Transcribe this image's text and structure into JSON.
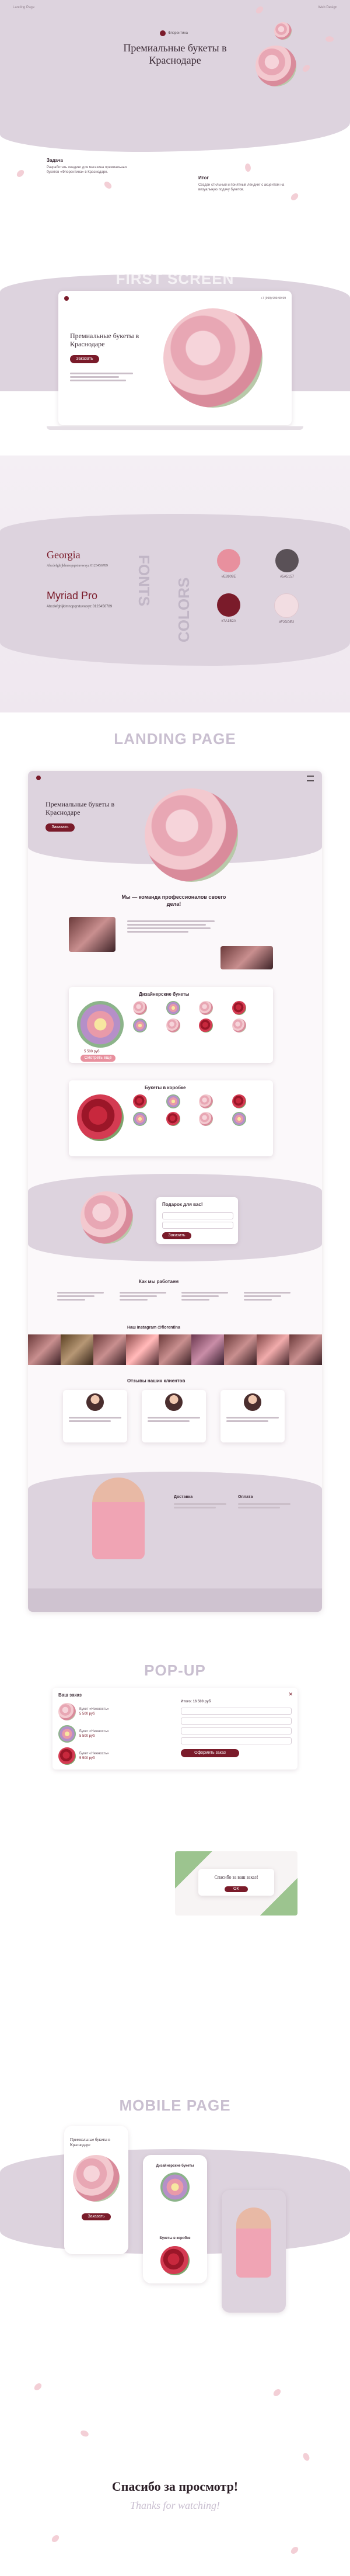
{
  "hero": {
    "top_left_text": "Landing Page",
    "top_right_text": "Web Design",
    "logo_text": "Флорентина",
    "title": "Премиальные букеты в Краснодаре",
    "task_title": "Задача",
    "task_text": "Разработать лендинг для магазина премиальных букетов «Флорентина» в Краснодаре.",
    "result_title": "Итог",
    "result_text": "Создан стильный и понятный лендинг с акцентом на визуальную подачу букетов."
  },
  "first_screen": {
    "section_title": "FIRST SCREEN",
    "mock_title": "Премиальные букеты в Краснодаре",
    "mock_button": "Заказать",
    "phone": "+7 (999) 999-99-99"
  },
  "style": {
    "font1_name": "Georgia",
    "font1_sample": "Abcdefghijklmnopqrstuvwxyz 0123456789",
    "font2_name": "Myriad Pro",
    "font2_sample": "Abcdefghijklmnopqrstuvwxyz 0123456789",
    "fonts_label": "FONTS",
    "colors_label": "COLORS",
    "colors": [
      {
        "hex": "#e8909e",
        "label": "#E8909E"
      },
      {
        "hex": "#5a5157",
        "label": "#5A5157"
      },
      {
        "hex": "#7a1b2a",
        "label": "#7A1B2A"
      },
      {
        "hex": "#f2dde2",
        "label": "#F2DDE2"
      }
    ]
  },
  "landing": {
    "section_title": "LANDING PAGE",
    "hero_title": "Премиальные букеты в Краснодаре",
    "hero_button": "Заказать",
    "about_title": "Мы — команда профессионалов своего дела!",
    "designer_title": "Дизайнерские букеты",
    "boxes_title": "Букеты в коробке",
    "gift_title": "Подарок для вас!",
    "how_title": "Как мы работаем",
    "insta_title": "Наш Instagram @florentina",
    "reviews_title": "Отзывы наших клиентов",
    "delivery_title": "Доставка",
    "payment_title": "Оплата",
    "price": "5 500 руб",
    "more_button": "Смотреть ещё"
  },
  "popup": {
    "section_title": "POP-UP",
    "cart_title": "Ваш заказ",
    "item_name": "Букет «Нежность»",
    "item_price": "5 500 руб",
    "total_label": "Итого: 16 500 руб",
    "form_title": "Оформить заказ",
    "submit": "Оформить заказ",
    "thanks_text": "Спасибо за ваш заказ!"
  },
  "mobile": {
    "section_title": "MOBILE PAGE",
    "hero_title": "Премиальные букеты в Краснодаре",
    "designer_title": "Дизайнерские букеты",
    "boxes_title": "Букеты в коробке",
    "button": "Заказать"
  },
  "footer": {
    "thanks_ru": "Спасибо за просмотр!",
    "thanks_en": "Thanks for watching!"
  }
}
